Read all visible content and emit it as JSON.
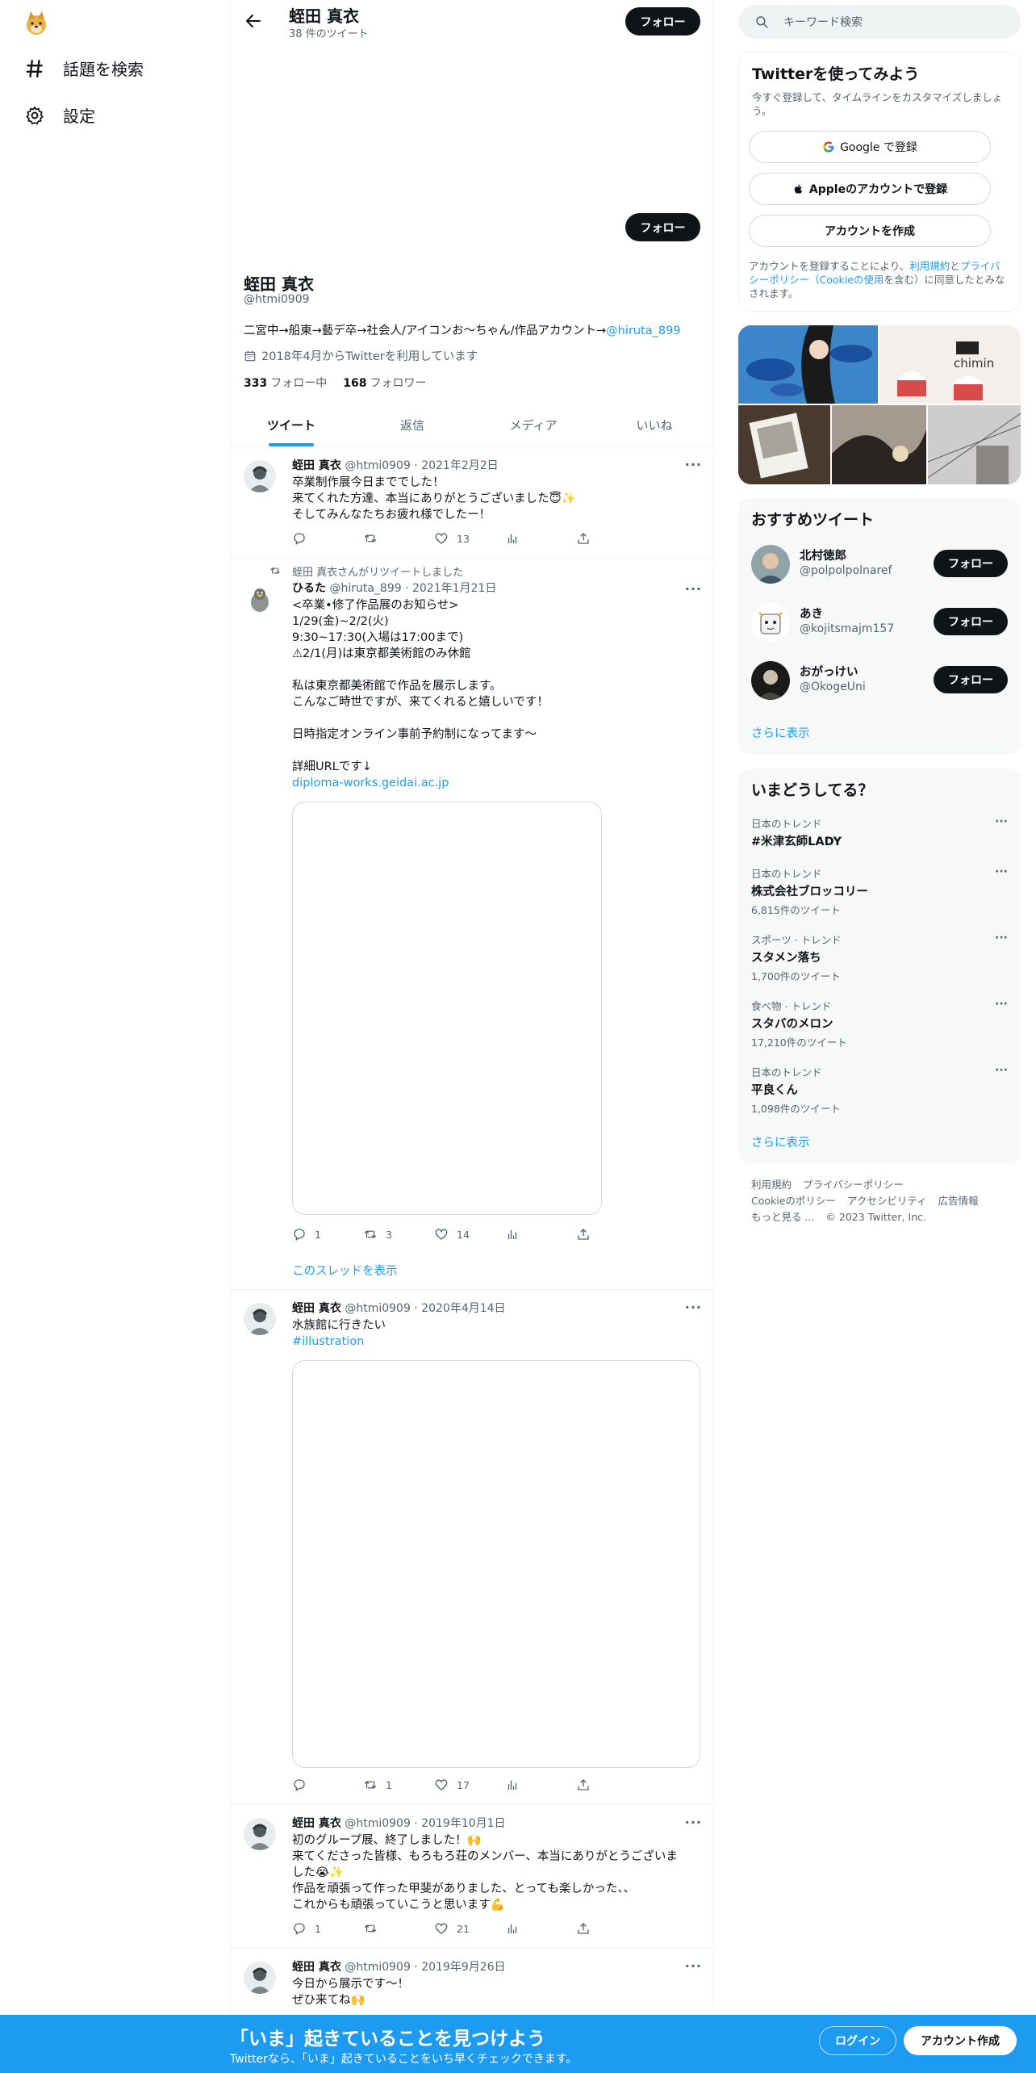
{
  "leftnav": {
    "items": [
      {
        "label": "話題を検索",
        "icon": "hashtag-icon"
      },
      {
        "label": "設定",
        "icon": "gear-icon"
      }
    ]
  },
  "header": {
    "name": "蛭田 真衣",
    "tweet_count": "38 件のツイート",
    "follow_label": "フォロー"
  },
  "profile": {
    "name": "蛭田 真衣",
    "handle": "@htmi0909",
    "follow_label": "フォロー",
    "bio_text": "二宮中→船東→藝デ卒→社会人/アイコンお〜ちゃん/作品アカウント→",
    "bio_link": "@hiruta_899",
    "joined": "2018年4月からTwitterを利用しています",
    "following_count": "333",
    "following_label": "フォロー中",
    "followers_count": "168",
    "followers_label": "フォロワー"
  },
  "tabs": [
    "ツイート",
    "返信",
    "メディア",
    "いいね"
  ],
  "tweets": [
    {
      "name": "蛭田 真衣",
      "meta": "@htmi0909 · 2021年2月2日",
      "text": "卒業制作展今日まででした！\n来てくれた方達、本当にありがとうございました😇✨\nそしてみんなたちお疲れ様でしたー！",
      "replies": "",
      "retweets": "",
      "likes": "13"
    },
    {
      "retweet_note": "蛭田 真衣さんがリツイートしました",
      "name": "ひるた",
      "meta": "@hiruta_899 · 2021年1月21日",
      "text": "<卒業•修了作品展のお知らせ>\n1/29(金)~2/2(火)\n9:30~17:30(入場は17:00まで)\n⚠︎2/1(月)は東京都美術館のみ休館\n\n私は東京都美術館で作品を展示します。\nこんなご時世ですが、来てくれると嬉しいです！\n\n日時指定オンライン事前予約制になってます〜\n\n詳細URLです↓",
      "link": "diploma-works.geidai.ac.jp",
      "replies": "1",
      "retweets": "3",
      "likes": "14",
      "thread_label": "このスレッドを表示"
    },
    {
      "name": "蛭田 真衣",
      "meta": "@htmi0909 · 2020年4月14日",
      "text": "水族館に行きたい",
      "hashtag": "#illustration",
      "replies": "",
      "retweets": "1",
      "likes": "17"
    },
    {
      "name": "蛭田 真衣",
      "meta": "@htmi0909 · 2019年10月1日",
      "text": "初のグループ展、終了しました！🙌\n来てくださった皆様、もろもろ荘のメンバー、本当にありがとうございま\nした😭✨\n作品を頑張って作った甲斐がありました、とっても楽しかった、、\nこれからも頑張っていこうと思います💪",
      "replies": "1",
      "retweets": "",
      "likes": "21"
    },
    {
      "name": "蛭田 真衣",
      "meta": "@htmi0909 · 2019年9月26日",
      "text": "今日から展示です〜！\nぜひ来てね🙌"
    }
  ],
  "search": {
    "placeholder": "キーワード検索"
  },
  "signup": {
    "title": "Twitterを使ってみよう",
    "subtitle": "今すぐ登録して、タイムラインをカスタマイズしましょう。",
    "google": "Google で登録",
    "apple": "Appleのアカウントで登録",
    "create": "アカウントを作成",
    "terms_1": "アカウントを登録することにより、",
    "terms_link1": "利用規約",
    "terms_2": "と",
    "terms_link2": "プライバシーポリシー（Cookieの使用",
    "terms_3": "を含む）に同意したとみなされます。"
  },
  "recommend": {
    "title": "おすすめツイート",
    "users": [
      {
        "name": "北村徳郎",
        "handle": "@polpolpolnaref"
      },
      {
        "name": "あき",
        "handle": "@kojitsmajm157"
      },
      {
        "name": "おがっけい",
        "handle": "@OkogeUni"
      }
    ],
    "follow_label": "フォロー",
    "more": "さらに表示"
  },
  "trends": {
    "title": "いまどうしてる？",
    "items": [
      {
        "category": "日本のトレンド",
        "name": "#米津玄師LADY",
        "count": ""
      },
      {
        "category": "日本のトレンド",
        "name": "株式会社ブロッコリー",
        "count": "6,815件のツイート"
      },
      {
        "category": "スポーツ · トレンド",
        "name": "スタメン落ち",
        "count": "1,700件のツイート"
      },
      {
        "category": "食べ物 · トレンド",
        "name": "スタバのメロン",
        "count": "17,210件のツイート"
      },
      {
        "category": "日本のトレンド",
        "name": "平良くん",
        "count": "1,098件のツイート"
      }
    ],
    "more": "さらに表示"
  },
  "footer": {
    "links": [
      "利用規約",
      "プライバシーポリシー",
      "Cookieのポリシー",
      "アクセシビリティ",
      "広告情報",
      "もっと見る ..."
    ],
    "copyright": "© 2023 Twitter, Inc."
  },
  "bottombar": {
    "title": "「いま」起きていることを見つけよう",
    "subtitle": "Twitterなら、「いま」起きていることをいち早くチェックできます。",
    "login": "ログイン",
    "signup": "アカウント作成"
  },
  "colors": {
    "accent": "#1d9bf0",
    "text": "#0f1419",
    "muted": "#536471",
    "panel": "#f7f9f9"
  }
}
